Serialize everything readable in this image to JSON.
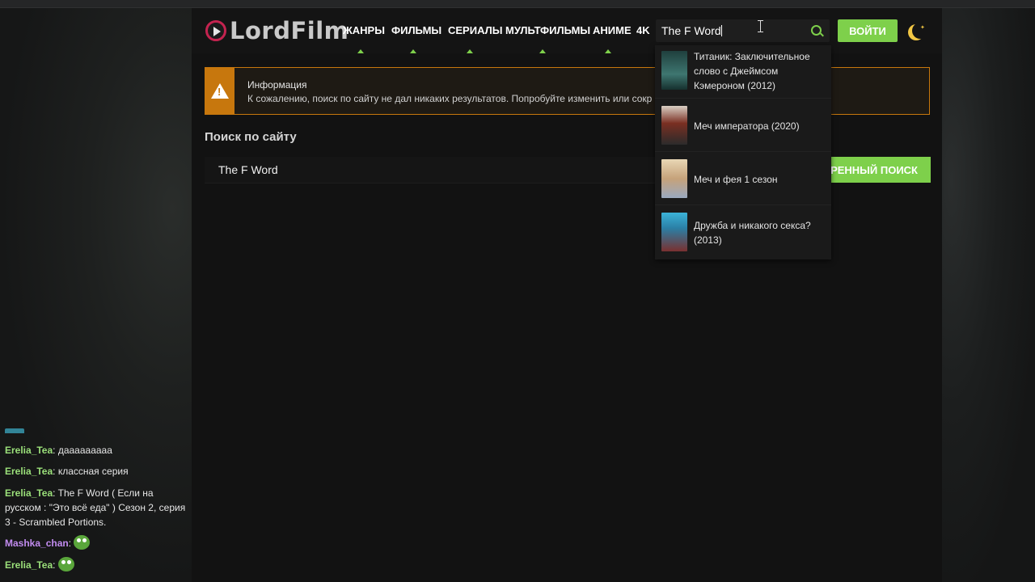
{
  "header": {
    "logo_text": "LordFilm",
    "nav": [
      "ЖАНРЫ",
      "ФИЛЬМЫ",
      "СЕРИАЛЫ",
      "МУЛЬТФИЛЬМЫ",
      "АНИМЕ",
      "4K"
    ],
    "search_value": "The F Word",
    "login_label": "ВОЙТИ"
  },
  "info": {
    "title": "Информация",
    "text": "К сожалению, поиск по сайту не дал никаких результатов. Попробуйте изменить или сокр"
  },
  "search_section": {
    "title": "Поиск по сайту",
    "query": "The F Word",
    "advanced_label": "ШИРЕННЫЙ ПОИСК"
  },
  "dropdown": [
    {
      "title": "Титаник: Заключительное слово с Джеймсом Кэмероном (2012)",
      "thumb_color": "#2f5b58"
    },
    {
      "title": "Меч императора (2020)",
      "thumb_color": "#6b3a2a"
    },
    {
      "title": "Меч и фея 1 сезон",
      "thumb_color": "#b9a58a"
    },
    {
      "title": "Дружба и никакого секса? (2013)",
      "thumb_color": "#2b7fa5"
    }
  ],
  "chat": [
    {
      "user": "Erelia_Tea",
      "text": ": дааааааааа"
    },
    {
      "user": "Erelia_Tea",
      "text": ": классная серия"
    },
    {
      "user": "Erelia_Tea",
      "text": ": The F Word ( Если на русском : \"Это всё еда\" ) Сезон 2, серия 3 - Scrambled Portions."
    },
    {
      "user": "Mashka_chan",
      "text": ":"
    },
    {
      "user": "Erelia_Tea",
      "text": ":"
    }
  ],
  "colors": {
    "accent": "#7ed04b",
    "warning": "#c7770d",
    "brand": "#c4234f"
  }
}
